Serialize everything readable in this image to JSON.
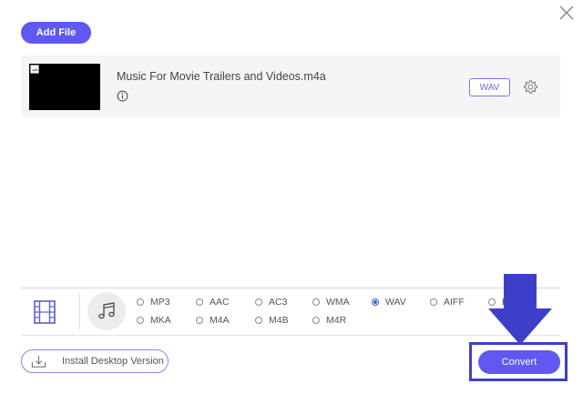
{
  "header": {
    "add_file_label": "Add File"
  },
  "file": {
    "name": "Music For Movie Trailers and Videos.m4a",
    "output_format": "WAV"
  },
  "formats": {
    "selected": "WAV",
    "options": [
      "MP3",
      "AAC",
      "AC3",
      "WMA",
      "WAV",
      "AIFF",
      "F",
      "MKA",
      "M4A",
      "M4B",
      "M4R"
    ]
  },
  "footer": {
    "install_label": "Install Desktop Version",
    "convert_label": "Convert"
  },
  "colors": {
    "accent": "#6158f2",
    "highlight": "#3e3fc9",
    "row_bg": "#f5f5f5"
  }
}
